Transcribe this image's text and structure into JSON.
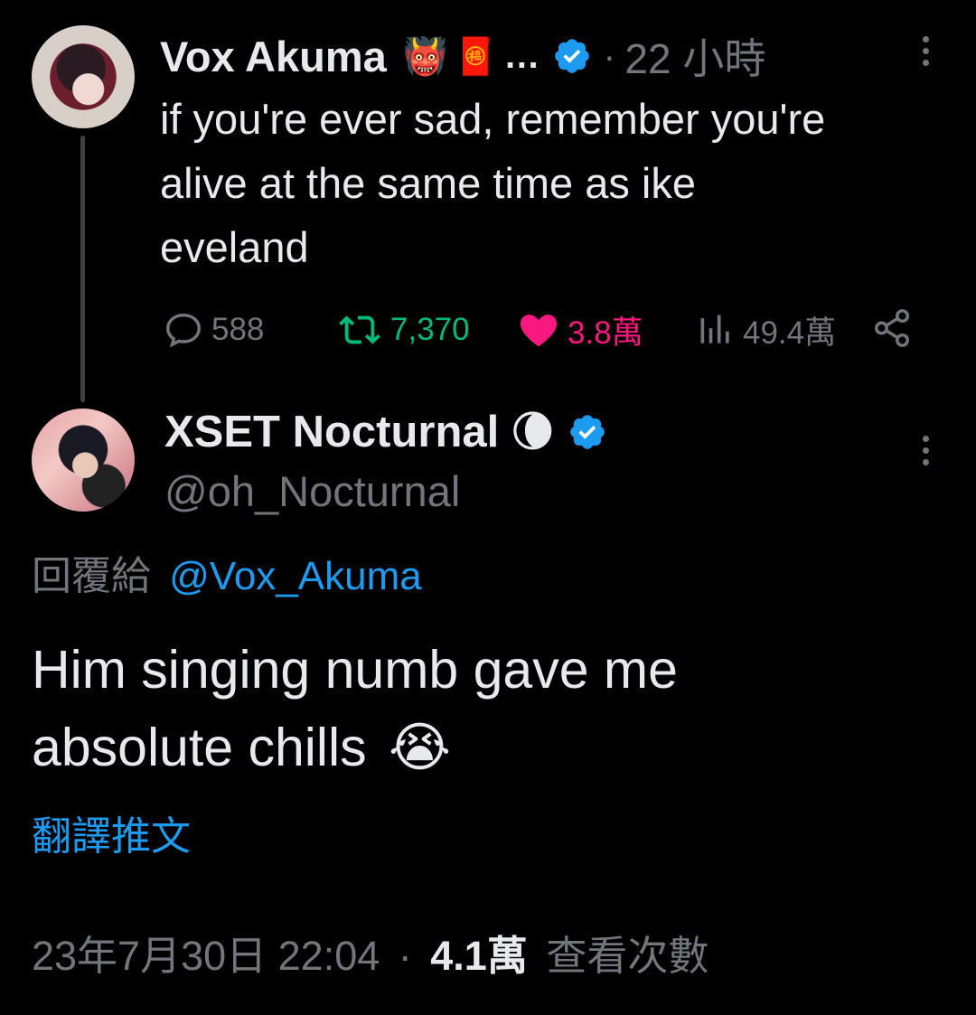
{
  "parent_tweet": {
    "author_name": "Vox Akuma",
    "emoji_1": "👹",
    "emoji_2": "🧧",
    "ellipsis": "…",
    "separator": "·",
    "time": "22 小時",
    "text_line_1": "if you're ever sad, remember you're",
    "text_line_2": "alive at the same time as ike",
    "text_line_3": "eveland",
    "replies": "588",
    "retweets": "7,370",
    "likes": "3.8萬",
    "views": "49.4萬"
  },
  "reply_tweet": {
    "author_name": "XSET Nocturnal",
    "name_emoji": "🌘",
    "handle": "@oh_Nocturnal",
    "reply_to_label": "回覆給",
    "reply_to_handle": "@Vox_Akuma",
    "text_line_1": "Him singing numb gave me",
    "text_line_2": "absolute chills",
    "text_emoji": "😭",
    "translate_label": "翻譯推文",
    "date_time": "23年7月30日 22:04",
    "separator": "·",
    "view_count": "4.1萬",
    "view_label": "查看次數"
  },
  "colors": {
    "background": "#000000",
    "text_primary": "#e7e9ea",
    "text_muted": "#71767b",
    "link_blue": "#1d9bf0",
    "retweet_green": "#00ba7c",
    "like_pink": "#f91880",
    "verified_blue": "#1d9bf0"
  },
  "icons": {
    "verified": "verified-badge-icon",
    "more": "more-vertical-icon",
    "reply": "comment-bubble-icon",
    "retweet": "retweet-icon",
    "like": "heart-icon",
    "views": "bar-chart-icon",
    "share": "share-icon"
  }
}
